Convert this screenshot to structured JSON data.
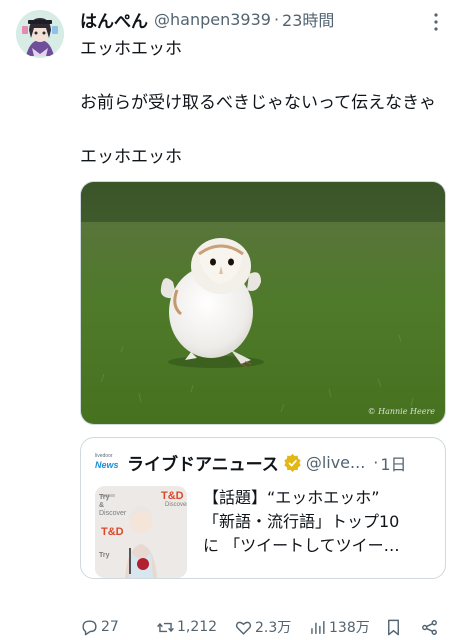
{
  "tweet": {
    "display_name": "はんぺん",
    "handle": "@hanpen3939",
    "separator": "·",
    "time": "23時間",
    "text": "エッホエッホ\n\nお前らが受け取るべきじゃないって伝えなきゃ\n\nエッホエッホ",
    "avatar_icon": "anime-avatar",
    "more_icon": "more-dots-icon"
  },
  "media": {
    "watermark": "© Hannie Heere"
  },
  "quote": {
    "logo_top": "livedoor",
    "logo_main": "News",
    "name": "ライブドアニュース",
    "verified_icon": "verified-gold-badge",
    "handle": "@live...",
    "separator": "·",
    "time": "1日",
    "line1": "【話題】“エッホエッホ”",
    "line2": "「新語・流行語」トップ10",
    "line3": "に 「ツイートしてツイー…",
    "thumb": {
      "brand_td": "T&D",
      "brand_try": "Try",
      "brand_amp": "&",
      "brand_discover": "Discover"
    }
  },
  "actions": {
    "reply_count": "27",
    "retweet_count": "1,212",
    "like_count": "2.3万",
    "view_count": "138万",
    "icons": [
      "reply-icon",
      "retweet-icon",
      "like-icon",
      "views-icon",
      "bookmark-icon",
      "share-icon"
    ]
  },
  "colors": {
    "text": "#0f1419",
    "secondary": "#536471",
    "border": "#cfd9de",
    "grass": "#4f7a2a",
    "verified": "#e2b719"
  }
}
